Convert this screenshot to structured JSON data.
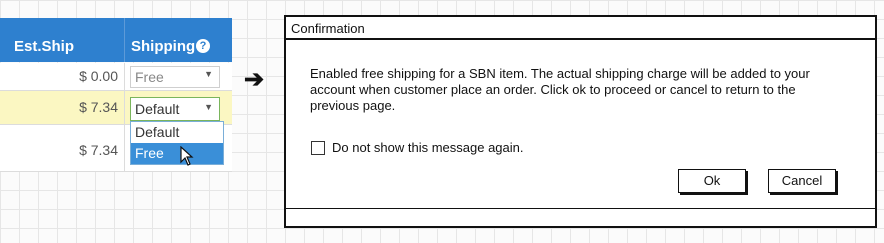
{
  "table": {
    "headers": {
      "est_ship": "Est.Ship",
      "shipping": "Shipping"
    },
    "help_icon": "?",
    "rows": [
      {
        "price": "$ 0.00",
        "shipping": "Free"
      },
      {
        "price": "$ 7.34",
        "shipping": "Default"
      },
      {
        "price": "$ 7.34"
      }
    ],
    "dropdown_options": [
      "Default",
      "Free"
    ]
  },
  "arrow": "➔",
  "dialog": {
    "title": "Confirmation",
    "message": "Enabled free shipping for a SBN item. The actual shipping charge will be added to your account when customer place an order. Click ok to proceed or cancel to return to the previous page.",
    "checkbox_label": "Do not show this message again.",
    "ok_label": "Ok",
    "cancel_label": "Cancel"
  },
  "colors": {
    "header_blue": "#2e80cf",
    "highlight_row": "#fbf7c2",
    "selected_option": "#3a8fd8"
  }
}
